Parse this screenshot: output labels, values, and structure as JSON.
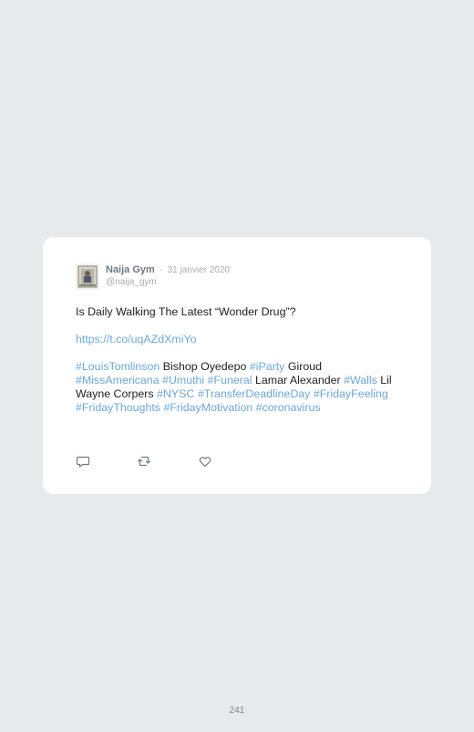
{
  "tweet": {
    "author_name": "Naija Gym",
    "separator": "·",
    "date": "31 janvier 2020",
    "handle": "@naija_gym",
    "headline": "Is Daily Walking The Latest “Wonder Drug”?",
    "link": "https://t.co/uqAZdXmiYo",
    "body_segments": [
      {
        "text": "#LouisTomlinson",
        "type": "hashtag"
      },
      {
        "text": " Bishop Oyedepo ",
        "type": "plain"
      },
      {
        "text": "#iParty",
        "type": "hashtag"
      },
      {
        "text": " Giroud ",
        "type": "plain"
      },
      {
        "text": "#MissAmericana",
        "type": "hashtag"
      },
      {
        "text": " ",
        "type": "plain"
      },
      {
        "text": "#Umuthi",
        "type": "hashtag"
      },
      {
        "text": " ",
        "type": "plain"
      },
      {
        "text": "#Funeral",
        "type": "hashtag"
      },
      {
        "text": " Lamar Alexander ",
        "type": "plain"
      },
      {
        "text": "#Walls",
        "type": "hashtag"
      },
      {
        "text": " Lil Wayne Corpers ",
        "type": "plain"
      },
      {
        "text": "#NYSC",
        "type": "hashtag"
      },
      {
        "text": " ",
        "type": "plain"
      },
      {
        "text": "#TransferDeadlineDay",
        "type": "hashtag"
      },
      {
        "text": " ",
        "type": "plain"
      },
      {
        "text": "#FridayFeeling",
        "type": "hashtag"
      },
      {
        "text": " ",
        "type": "plain"
      },
      {
        "text": "#FridayThoughts",
        "type": "hashtag"
      },
      {
        "text": " ",
        "type": "plain"
      },
      {
        "text": "#FridayMotivation",
        "type": "hashtag"
      },
      {
        "text": " ",
        "type": "plain"
      },
      {
        "text": "#coronavirus",
        "type": "hashtag"
      }
    ],
    "actions": [
      {
        "name": "reply-icon"
      },
      {
        "name": "retweet-icon"
      },
      {
        "name": "like-icon"
      }
    ]
  },
  "colors": {
    "background": "#e6eaed",
    "card": "#ffffff",
    "link": "#6aa8de",
    "muted": "#a3adb6",
    "icon": "#6e7a85"
  },
  "page_number": "241"
}
